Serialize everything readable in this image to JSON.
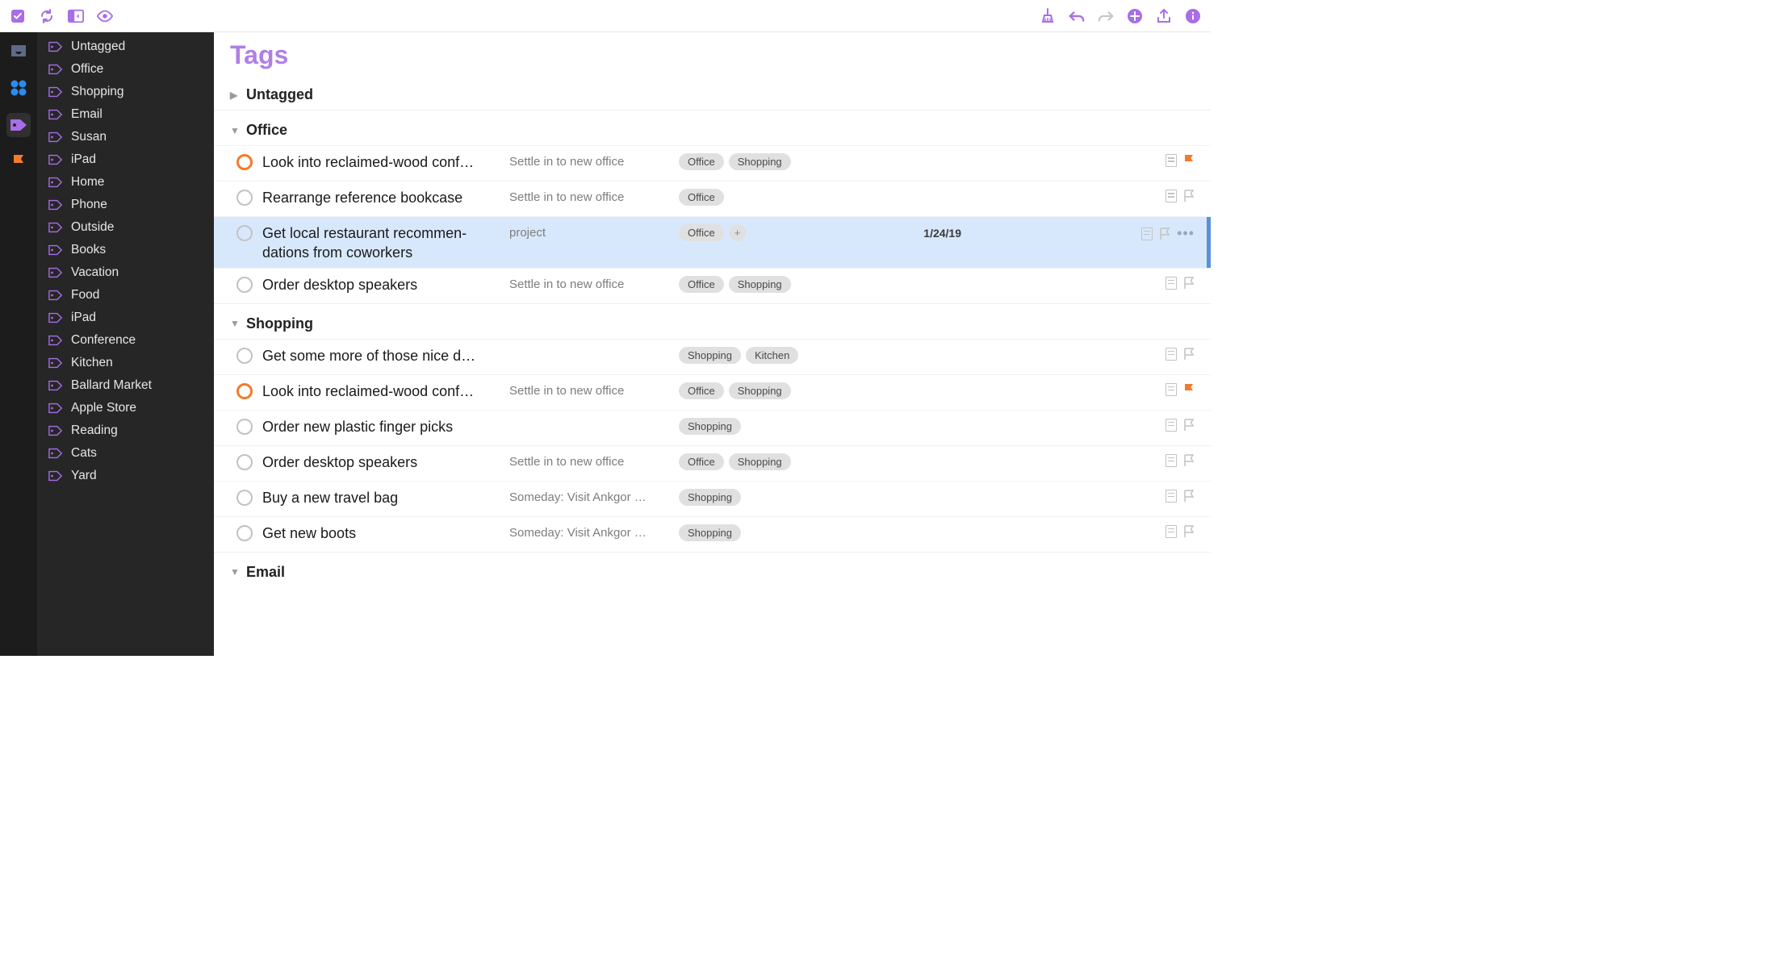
{
  "colors": {
    "accent": "#a96de8",
    "flag": "#f47a2e",
    "selection": "#d8e8fc"
  },
  "toolbar": {
    "left": [
      "check-icon",
      "sync-icon",
      "sidebar-toggle-icon",
      "eye-icon"
    ],
    "right": [
      "cleanup-icon",
      "undo-icon",
      "redo-icon",
      "add-icon",
      "share-icon",
      "info-icon"
    ]
  },
  "rail": [
    {
      "name": "inbox-icon",
      "active": false,
      "color": "#5e6a86"
    },
    {
      "name": "forecast-icon",
      "active": false,
      "color": "#2b8cf0"
    },
    {
      "name": "tags-icon",
      "active": true,
      "color": "#a96de8"
    },
    {
      "name": "flagged-icon",
      "active": false,
      "color": "#f47a2e"
    }
  ],
  "sidebar": {
    "items": [
      {
        "label": "Untagged"
      },
      {
        "label": "Office"
      },
      {
        "label": "Shopping"
      },
      {
        "label": "Email"
      },
      {
        "label": "Susan"
      },
      {
        "label": "iPad"
      },
      {
        "label": "Home"
      },
      {
        "label": "Phone"
      },
      {
        "label": "Outside"
      },
      {
        "label": "Books"
      },
      {
        "label": "Vacation"
      },
      {
        "label": "Food"
      },
      {
        "label": "iPad"
      },
      {
        "label": "Conference"
      },
      {
        "label": "Kitchen"
      },
      {
        "label": "Ballard Market"
      },
      {
        "label": "Apple Store"
      },
      {
        "label": "Reading"
      },
      {
        "label": "Cats"
      },
      {
        "label": "Yard"
      }
    ]
  },
  "page": {
    "title": "Tags"
  },
  "sections": [
    {
      "title": "Untagged",
      "expanded": false,
      "tasks": []
    },
    {
      "title": "Office",
      "expanded": true,
      "tasks": [
        {
          "title": "Look into reclaimed-wood conf…",
          "wrap": false,
          "project": "Settle in to new office",
          "tags": [
            "Office",
            "Shopping"
          ],
          "flagged": true,
          "date": "",
          "selected": false
        },
        {
          "title": "Rearrange reference bookcase",
          "wrap": false,
          "project": "Settle in to new office",
          "tags": [
            "Office"
          ],
          "flagged": false,
          "date": "",
          "selected": false
        },
        {
          "title": "Get local restaurant recommen-dations from coworkers",
          "wrap": true,
          "project": "project",
          "tags": [
            "Office"
          ],
          "plus": true,
          "flagged": false,
          "date": "1/24/19",
          "selected": true
        },
        {
          "title": "Order desktop speakers",
          "wrap": false,
          "project": "Settle in to new office",
          "tags": [
            "Office",
            "Shopping"
          ],
          "flagged": false,
          "date": "",
          "selected": false
        }
      ]
    },
    {
      "title": "Shopping",
      "expanded": true,
      "tasks": [
        {
          "title": "Get some more of those nice d…",
          "wrap": false,
          "project": "",
          "tags": [
            "Shopping",
            "Kitchen"
          ],
          "flagged": false,
          "date": "",
          "selected": false
        },
        {
          "title": "Look into reclaimed-wood conf…",
          "wrap": false,
          "project": "Settle in to new office",
          "tags": [
            "Office",
            "Shopping"
          ],
          "flagged": true,
          "date": "",
          "selected": false
        },
        {
          "title": "Order new plastic finger picks",
          "wrap": false,
          "project": "",
          "tags": [
            "Shopping"
          ],
          "flagged": false,
          "date": "",
          "selected": false
        },
        {
          "title": "Order desktop speakers",
          "wrap": false,
          "project": "Settle in to new office",
          "tags": [
            "Office",
            "Shopping"
          ],
          "flagged": false,
          "date": "",
          "selected": false
        },
        {
          "title": "Buy a new travel bag",
          "wrap": false,
          "project": "Someday: Visit Ankgor …",
          "tags": [
            "Shopping"
          ],
          "flagged": false,
          "date": "",
          "selected": false
        },
        {
          "title": "Get new boots",
          "wrap": false,
          "project": "Someday: Visit Ankgor …",
          "tags": [
            "Shopping"
          ],
          "flagged": false,
          "date": "",
          "selected": false
        }
      ]
    },
    {
      "title": "Email",
      "expanded": true,
      "tasks": []
    }
  ]
}
